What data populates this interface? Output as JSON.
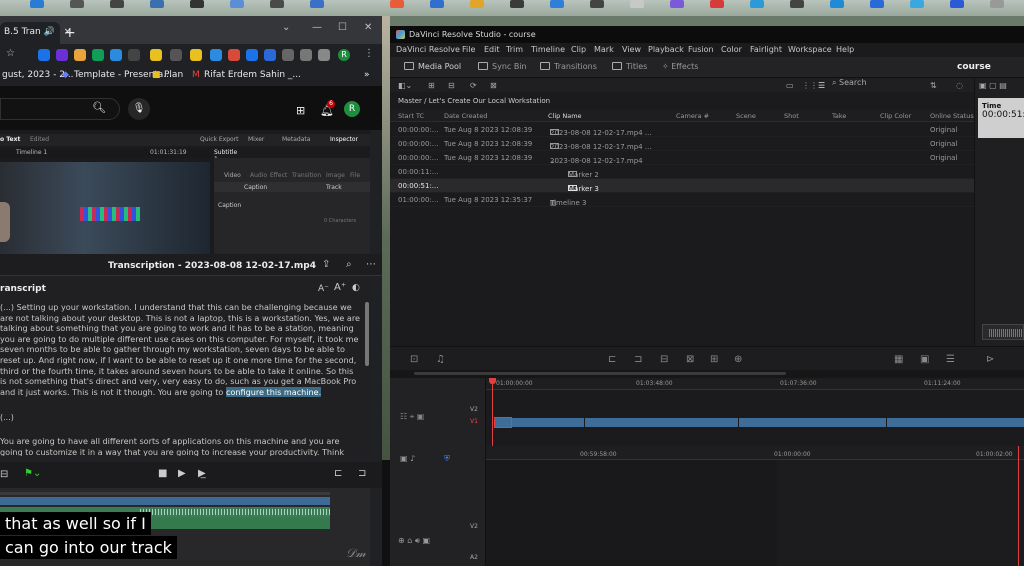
{
  "chrome": {
    "tab_title": "B.5 Tran",
    "tab_close": "×",
    "new_tab": "+",
    "win_min": "⌄",
    "win_restore": "—",
    "win_max": "☐",
    "win_close": "✕",
    "bookmarks": [
      "gust, 2023 - 2...",
      "Template - Presenta...",
      "Plan",
      "Rifat Erdem Sahin _..."
    ],
    "bookmarks_more": "»",
    "profile_initial": "R"
  },
  "youtube": {
    "notif_count": "6",
    "avatar_initial": "R"
  },
  "embedded": {
    "text_tab": "o Text",
    "text_tab_sub": "Edited",
    "timeline": "Timeline 1",
    "timecode": "01:01:31:19",
    "quick_export": "Quick Export",
    "mixer": "Mixer",
    "metadata": "Metadata",
    "inspector": "Inspector",
    "subtitle": "Subtitle 1",
    "insp_tabs": [
      "Video",
      "Audio",
      "Effect",
      "Transition",
      "Image",
      "File"
    ],
    "caption_tab": "Caption",
    "track_tab": "Track",
    "caption_label": "Caption",
    "char_count": "0 Characters"
  },
  "transcript": {
    "title": "Transcription - 2023-08-08 12-02-17.mp4",
    "label": "ranscript",
    "font_small": "A⁻",
    "font_large": "A⁺",
    "para1": "(...) Setting up your workstation. I understand that this can be challenging because we are not talking about your desktop. This is not a laptop, this is a workstation. Yes, we are talking about something that you are going to work and it has to be a station, meaning you are going to do multiple different use cases on this computer. For myself, it took me seven months to be able to gather through my workstation, seven days to be able to reset up. And right now, if I want to be able to reset up it one more time for the second, third or the fourth time, it takes around seven hours to be able to take it online. So this is not something that's direct and very, very easy to do, such as you get a MacBook Pro and it just works. This is not it though. You are going to",
    "highlight": "configure this machine.",
    "ellipsis": "(...)",
    "para2": "You are going to have all different sorts of applications on this machine and you are going to customize it in a way that you are going to increase your productivity. Think about you are"
  },
  "captions": {
    "line1": "that as well so if I",
    "line2": "can go into our track"
  },
  "resolve": {
    "window_title": "DaVinci Resolve Studio - course",
    "menu": [
      "DaVinci Resolve",
      "File",
      "Edit",
      "Trim",
      "Timeline",
      "Clip",
      "Mark",
      "View",
      "Playback",
      "Fusion",
      "Color",
      "Fairlight",
      "Workspace",
      "Help"
    ],
    "toolbar": {
      "media_pool": "Media Pool",
      "sync_bin": "Sync Bin",
      "transitions": "Transitions",
      "titles": "Titles",
      "effects": "Effects"
    },
    "project_name": "course",
    "search_placeholder": "Search",
    "path": "Master / Let's Create Our Local Workstation",
    "columns": [
      "Start TC",
      "Date Created",
      "Clip Name",
      "Camera #",
      "Scene",
      "Shot",
      "Take",
      "Clip Color",
      "Online Status"
    ],
    "rows": [
      {
        "tc": "00:00:00:...",
        "date": "Tue Aug 8 2023 12:08:39",
        "name": "2023-08-08 12-02-17.mp4 ...",
        "status": "Original"
      },
      {
        "tc": "00:00:00:...",
        "date": "Tue Aug 8 2023 12:08:39",
        "name": "2023-08-08 12-02-17.mp4 ...",
        "status": "Original"
      },
      {
        "tc": "00:00:00:...",
        "date": "Tue Aug 8 2023 12:08:39",
        "name": "2023-08-08 12-02-17.mp4",
        "status": "Original"
      },
      {
        "tc": "00:00:11:...",
        "date": "",
        "name": "Marker 2",
        "status": ""
      },
      {
        "tc": "00:00:51:...",
        "date": "",
        "name": "Marker 3",
        "status": ""
      },
      {
        "tc": "01:00:00:...",
        "date": "Tue Aug 8 2023 12:35:37",
        "name": "Timeline 3",
        "status": ""
      }
    ],
    "side_time_label": "Time",
    "side_time_value": "00:00:51:",
    "ruler_upper": [
      "01:00:00:00",
      "01:03:48:00",
      "01:07:36:00",
      "01:11:24:00"
    ],
    "ruler_lower": [
      "00:59:58:00",
      "01:00:00:00",
      "01:00:02:00"
    ],
    "track_labels": {
      "v2": "V2",
      "v1": "V1",
      "v2_lower": "V2",
      "a2": "A2"
    }
  },
  "colors": {
    "accent_red": "#e04040",
    "clip_blue": "#3f6d9a",
    "audio_green": "#357a4d",
    "highlight": "#3c6b86"
  }
}
